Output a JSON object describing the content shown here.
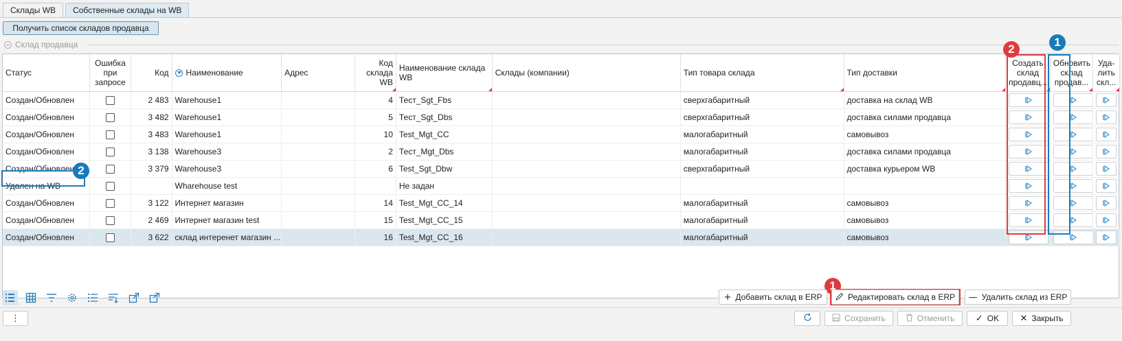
{
  "tabs": [
    {
      "label": "Склады WB"
    },
    {
      "label": "Собственные склады на WB"
    }
  ],
  "get_list_button": "Получить список складов продавца",
  "group_title": "Склад продавца",
  "columns": {
    "status": "Статус",
    "error": "Ошибка при запросе",
    "code": "Код",
    "name": "Наименование",
    "address": "Адрес",
    "wb_code": "Код склада WB",
    "wb_name": "Наименование склада WB",
    "companies": "Склады (компании)",
    "goods_type": "Тип товара склада",
    "delivery_type": "Тип доставки",
    "create": "Создать склад продавц...",
    "update": "Обновить склад продав...",
    "delete": "Уда-лить скл..."
  },
  "rows": [
    {
      "status": "Создан/Обновлен",
      "code": "2 483",
      "name": "Warehouse1",
      "address": "",
      "wb_code": "4",
      "wb_name": "Тест_Sgt_Fbs",
      "companies": "",
      "goods_type": "сверхгабаритный",
      "delivery_type": "доставка на склад WB"
    },
    {
      "status": "Создан/Обновлен",
      "code": "3 482",
      "name": "Warehouse1",
      "address": "",
      "wb_code": "5",
      "wb_name": "Тест_Sgt_Dbs",
      "companies": "",
      "goods_type": "сверхгабаритный",
      "delivery_type": "доставка силами продавца"
    },
    {
      "status": "Создан/Обновлен",
      "code": "3 483",
      "name": "Warehouse1",
      "address": "",
      "wb_code": "10",
      "wb_name": "Test_Mgt_CC",
      "companies": "",
      "goods_type": "малогабаритный",
      "delivery_type": "самовывоз"
    },
    {
      "status": "Создан/Обновлен",
      "code": "3 138",
      "name": "Warehouse3",
      "address": "",
      "wb_code": "2",
      "wb_name": "Тест_Mgt_Dbs",
      "companies": "",
      "goods_type": "малогабаритный",
      "delivery_type": "доставка силами продавца"
    },
    {
      "status": "Создан/Обновлен",
      "code": "3 379",
      "name": "Warehouse3",
      "address": "",
      "wb_code": "6",
      "wb_name": "Test_Sgt_Dbw",
      "companies": "",
      "goods_type": "сверхгабаритный",
      "delivery_type": "доставка курьером WB"
    },
    {
      "status": "Удален на WB",
      "code": "",
      "name": "Wharehouse test",
      "address": "",
      "wb_code": "",
      "wb_name": "Не задан",
      "companies": "",
      "goods_type": "",
      "delivery_type": ""
    },
    {
      "status": "Создан/Обновлен",
      "code": "3 122",
      "name": "Интернет магазин",
      "address": "",
      "wb_code": "14",
      "wb_name": "Test_Mgt_CC_14",
      "companies": "",
      "goods_type": "малогабаритный",
      "delivery_type": "самовывоз"
    },
    {
      "status": "Создан/Обновлен",
      "code": "2 469",
      "name": "Интернет магазин test",
      "address": "",
      "wb_code": "15",
      "wb_name": "Test_Mgt_CC_15",
      "companies": "",
      "goods_type": "малогабаритный",
      "delivery_type": "самовывоз"
    },
    {
      "status": "Создан/Обновлен",
      "code": "3 622",
      "name": "склад интеренет магазин ...",
      "address": "",
      "wb_code": "16",
      "wb_name": "Test_Mgt_CC_16",
      "companies": "",
      "goods_type": "малогабаритный",
      "delivery_type": "самовывоз"
    }
  ],
  "badges": {
    "red1": "1",
    "red2": "2",
    "blue1": "1",
    "blue2": "2"
  },
  "buttons": {
    "add": "Добавить склад в ERP",
    "edit": "Редактировать склад в ERP",
    "delete": "Удалить склад из ERP",
    "more": "⋮",
    "save": "Сохранить",
    "cancel": "Отменить",
    "ok": "OK",
    "close": "Закрыть"
  },
  "colors": {
    "accent": "#1a7ab8",
    "highlight_red": "#e03a3e",
    "selected_row": "#dbe7ee"
  }
}
